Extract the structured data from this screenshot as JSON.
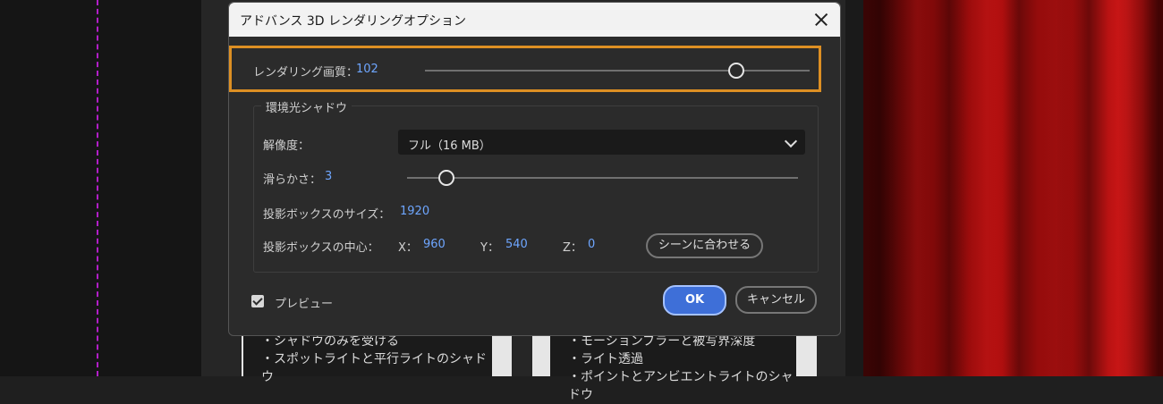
{
  "dialog": {
    "title": "アドバンス 3D レンダリングオプション",
    "quality": {
      "label": "レンダリング画質：",
      "value": "102",
      "slider_fraction": 0.81
    },
    "ambient_shadow": {
      "group_title": "環境光シャドウ",
      "resolution": {
        "label": "解像度：",
        "selected": "フル（16 MB）"
      },
      "smoothness": {
        "label": "滑らかさ：",
        "value": "3",
        "slider_fraction": 0.1
      },
      "projection_box_size": {
        "label": "投影ボックスのサイズ：",
        "value": "1920"
      },
      "projection_box_center": {
        "label": "投影ボックスの中心：",
        "x_label": "X：",
        "x_value": "960",
        "y_label": "Y：",
        "y_value": "540",
        "z_label": "Z：",
        "z_value": "0",
        "fit_button": "シーンに合わせる"
      }
    },
    "preview": {
      "label": "プレビュー",
      "checked": true
    },
    "ok_button": "OK",
    "cancel_button": "キャンセル"
  },
  "background": {
    "left_card_lines": [
      "・シャドウのみを受ける",
      "・スポットライトと平行ライトのシャドウ"
    ],
    "right_card_lines": [
      "・モーションブラーと被写界深度",
      "・ライト透過",
      "・ポイントとアンビエントライトのシャドウ"
    ]
  },
  "colors": {
    "accent_blue": "#3e6fd8",
    "highlight_orange": "#dd8f23",
    "value_blue": "#6ea6ff"
  }
}
